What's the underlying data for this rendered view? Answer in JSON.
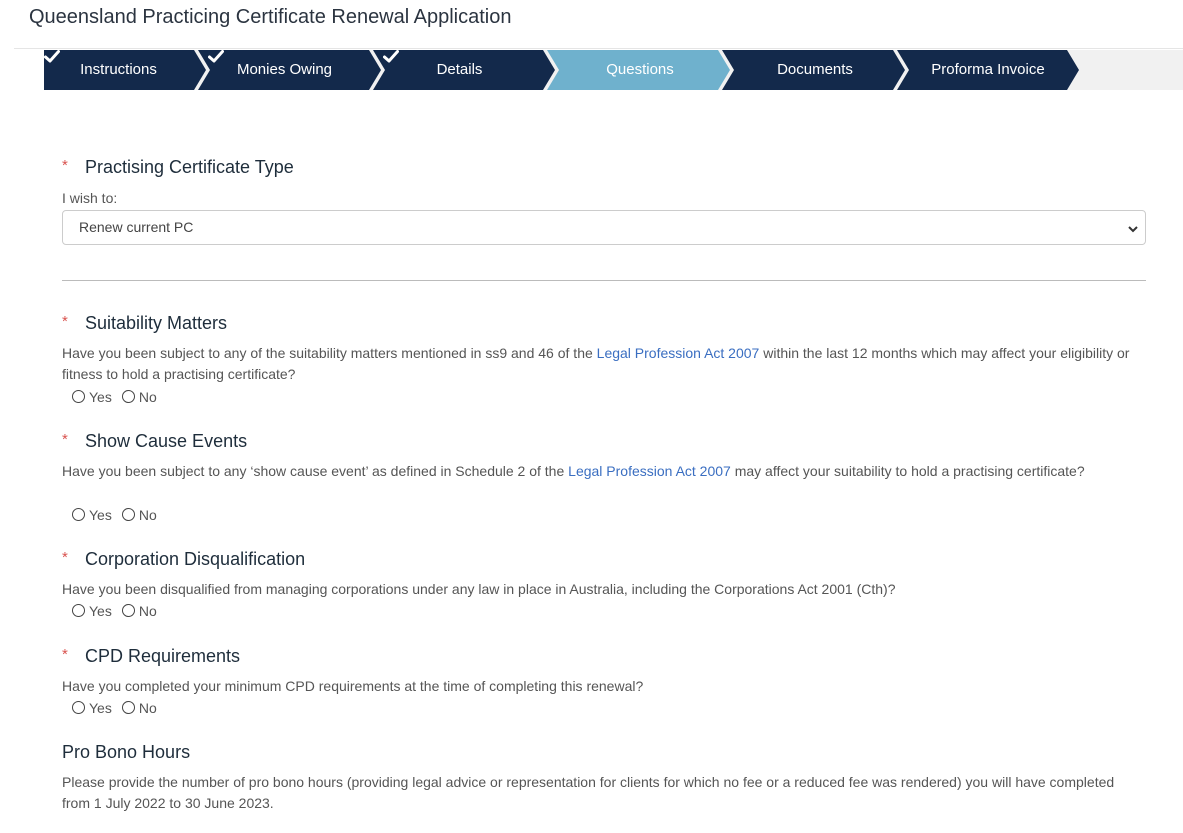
{
  "page": {
    "title": "Queensland Practicing Certificate Renewal Application"
  },
  "steps": [
    {
      "label": "Instructions",
      "completed": true
    },
    {
      "label": "Monies Owing",
      "completed": true
    },
    {
      "label": "Details",
      "completed": true
    },
    {
      "label": "Questions",
      "completed": false,
      "active": true
    },
    {
      "label": "Documents",
      "completed": false
    },
    {
      "label": "Proforma Invoice",
      "completed": false
    }
  ],
  "colors": {
    "step_done": "#13294b",
    "step_active": "#6fb1cd",
    "link": "#3a6ec1",
    "required": "#d9534f"
  },
  "pc_type": {
    "required_mark": "*",
    "heading": "Practising Certificate Type",
    "label": "I wish to:",
    "selected": "Renew current PC"
  },
  "act_link": "Legal Profession Act 2007",
  "radio": {
    "yes": "Yes",
    "no": "No"
  },
  "suitability": {
    "heading": "Suitability Matters",
    "question_before": "Have you been subject to any of the suitability matters mentioned in ss9 and 46 of the ",
    "question_after": " within the last 12 months which may affect your eligibility or fitness to hold a practising certificate?"
  },
  "show_cause": {
    "heading": "Show Cause Events",
    "question_before": "Have you been subject to any ‘show cause event’ as defined in Schedule 2 of the ",
    "question_after": " may affect your suitability to hold a practising certificate?"
  },
  "corporation": {
    "heading": "Corporation Disqualification",
    "question": "Have you been disqualified from managing corporations under any law in place in Australia, including the Corporations Act 2001 (Cth)?"
  },
  "cpd": {
    "heading": "CPD Requirements",
    "question": "Have you completed your minimum CPD requirements at the time of completing this renewal?"
  },
  "pro_bono": {
    "heading": "Pro Bono Hours",
    "question": "Please provide the number of pro bono hours (providing legal advice or representation for clients for which no fee or a reduced fee was rendered) you will have completed from 1 July 2022 to 30 June 2023."
  }
}
